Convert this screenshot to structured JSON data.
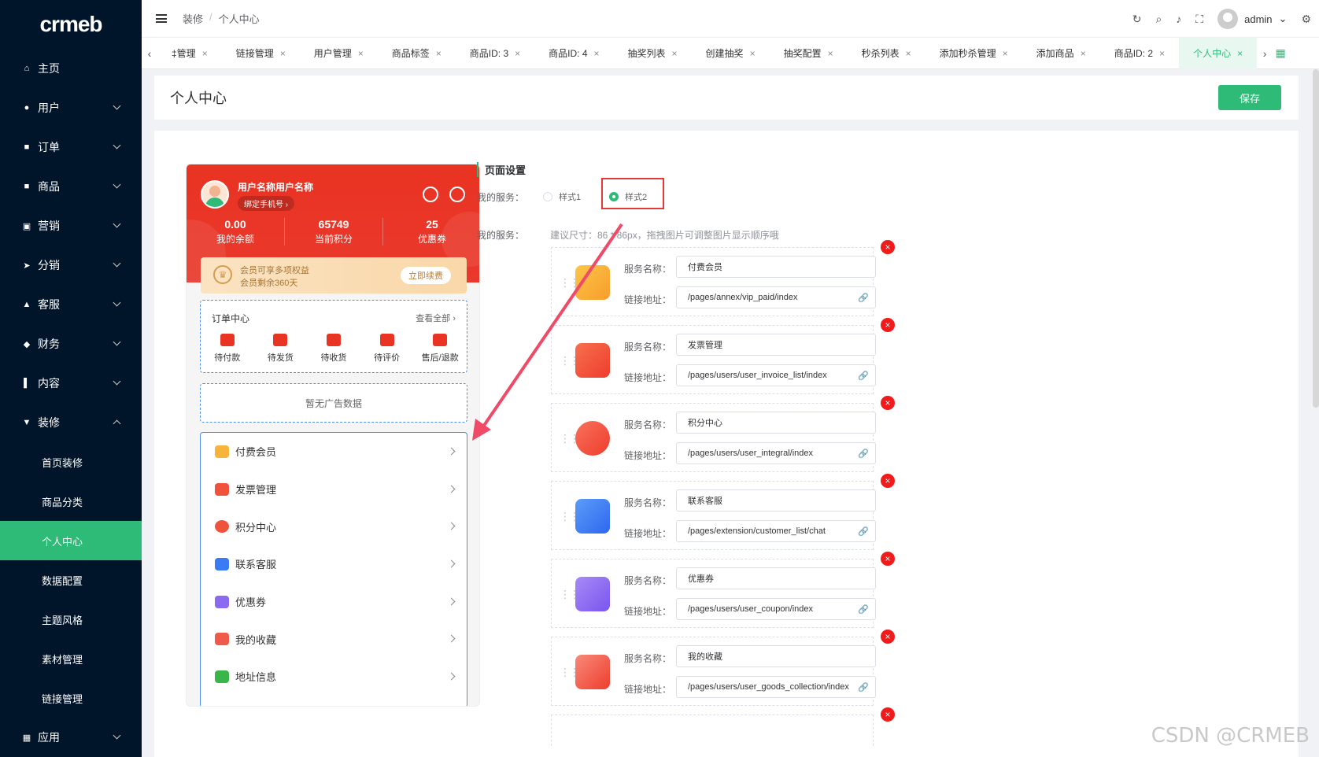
{
  "sidebar": {
    "logo": "crmeb",
    "items": [
      {
        "label": "主页",
        "icon": "home-icon",
        "has_arrow": false
      },
      {
        "label": "用户",
        "icon": "user-icon",
        "has_arrow": true
      },
      {
        "label": "订单",
        "icon": "order-icon",
        "has_arrow": true
      },
      {
        "label": "商品",
        "icon": "product-icon",
        "has_arrow": true
      },
      {
        "label": "营销",
        "icon": "marketing-icon",
        "has_arrow": true
      },
      {
        "label": "分销",
        "icon": "distribution-icon",
        "has_arrow": true
      },
      {
        "label": "客服",
        "icon": "service-icon",
        "has_arrow": true
      },
      {
        "label": "财务",
        "icon": "finance-icon",
        "has_arrow": true
      },
      {
        "label": "内容",
        "icon": "content-icon",
        "has_arrow": true
      },
      {
        "label": "装修",
        "icon": "decorate-icon",
        "has_arrow": true
      }
    ],
    "subitems": [
      "首页装修",
      "商品分类",
      "个人中心",
      "数据配置",
      "主题风格",
      "素材管理",
      "链接管理"
    ],
    "last": "应用"
  },
  "header": {
    "breadcrumb": [
      "装修",
      "个人中心"
    ],
    "user": "admin"
  },
  "tabs": [
    "‡管理",
    "链接管理",
    "用户管理",
    "商品标签",
    "商品ID: 3",
    "商品ID: 4",
    "抽奖列表",
    "创建抽奖",
    "抽奖配置",
    "秒杀列表",
    "添加秒杀管理",
    "添加商品",
    "商品ID: 2",
    "个人中心"
  ],
  "page": {
    "title": "个人中心",
    "save": "保存"
  },
  "phone": {
    "username": "用户名称用户名称",
    "bind": "绑定手机号 ›",
    "stats": [
      {
        "value": "0.00",
        "label": "我的余额"
      },
      {
        "value": "65749",
        "label": "当前积分"
      },
      {
        "value": "25",
        "label": "优惠券"
      }
    ],
    "vip_line1": "会员可享多项权益",
    "vip_line2": "会员剩余360天",
    "renew": "立即续费",
    "order_center": "订单中心",
    "view_all": "查看全部 ›",
    "orders": [
      "待付款",
      "待发货",
      "待收货",
      "待评价",
      "售后/退款"
    ],
    "no_ad": "暂无广告数据",
    "services": [
      "付费会员",
      "发票管理",
      "积分中心",
      "联系客服",
      "优惠券",
      "我的收藏",
      "地址信息"
    ]
  },
  "settings": {
    "section": "页面设置",
    "my_service": "我的服务：",
    "style1": "样式1",
    "style2": "样式2",
    "hint": "建议尺寸：86 * 86px，拖拽图片可调整图片显示顺序哦",
    "name_label": "服务名称：",
    "link_label": "链接地址：",
    "cards": [
      {
        "name": "付费会员",
        "link": "/pages/annex/vip_paid/index"
      },
      {
        "name": "发票管理",
        "link": "/pages/users/user_invoice_list/index"
      },
      {
        "name": "积分中心",
        "link": "/pages/users/user_integral/index"
      },
      {
        "name": "联系客服",
        "link": "/pages/extension/customer_list/chat"
      },
      {
        "name": "优惠券",
        "link": "/pages/users/user_coupon/index"
      },
      {
        "name": "我的收藏",
        "link": "/pages/users/user_goods_collection/index"
      }
    ]
  },
  "watermark": "CSDN @CRMEB",
  "colors": {
    "accent": "#2ebb77",
    "sidebar": "#001529",
    "red": "#e93323",
    "highlight": "#e53935"
  }
}
